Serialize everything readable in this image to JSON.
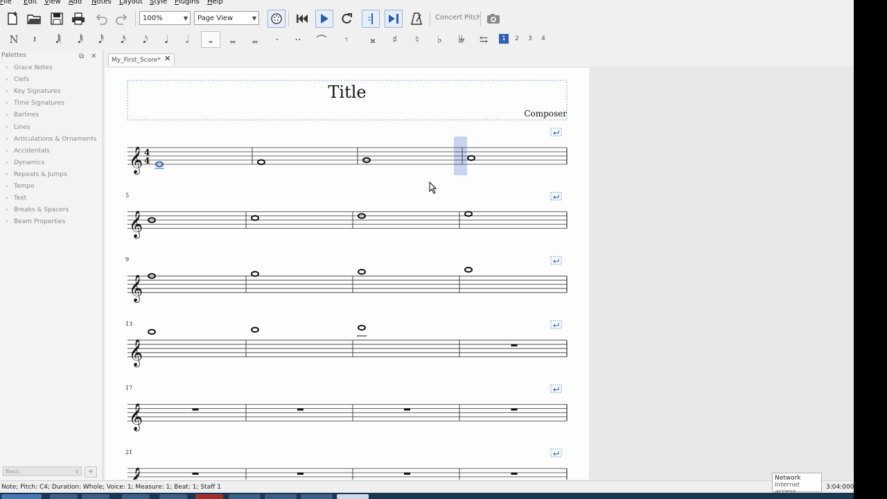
{
  "menu": [
    "File",
    "Edit",
    "View",
    "Add",
    "Notes",
    "Layout",
    "Style",
    "Plugins",
    "Help"
  ],
  "toolbar": {
    "zoom_value": "100%",
    "view_mode": "Page View",
    "concert_pitch": "Concert Pitch",
    "icons": [
      "new-score-icon",
      "open-icon",
      "save-icon",
      "print-icon",
      "undo-icon",
      "redo-icon",
      "midi-input-icon",
      "rewind-icon",
      "play-icon",
      "loop-icon",
      "loop-in-icon",
      "loop-out-icon",
      "metronome-icon",
      "image-capture-icon"
    ]
  },
  "note_input": {
    "buttons": [
      "N",
      "𝄽",
      "𝅘𝅥𝅲",
      "𝅘𝅥𝅱",
      "𝅘𝅥𝅰",
      "𝅘𝅥𝅯",
      "𝅘𝅥𝅮",
      "𝅘𝅥",
      "𝅗𝅥",
      "𝅝",
      "𝅜",
      "𝅜",
      "·",
      "··",
      "⌒",
      "𝄾",
      "𝄪",
      "♯",
      "♮",
      "♭",
      "𝄫",
      "⇆"
    ],
    "voices": [
      "1",
      "2",
      "3",
      "4"
    ],
    "active_voice": "1"
  },
  "palette": {
    "title": "Palettes",
    "items": [
      "Grace Notes",
      "Clefs",
      "Key Signatures",
      "Time Signatures",
      "Barlines",
      "Lines",
      "Articulations & Ornaments",
      "Accidentals",
      "Dynamics",
      "Repeats & Jumps",
      "Tempo",
      "Text",
      "Breaks & Spacers",
      "Beam Properties"
    ],
    "workspace": "Basic",
    "add_label": "+"
  },
  "tab": {
    "label": "My_First_Score*",
    "close": "✕"
  },
  "score": {
    "title": "Title",
    "composer": "Composer",
    "time_signature": [
      "4",
      "4"
    ],
    "measure_numbers": [
      "5",
      "9",
      "13",
      "17",
      "21"
    ],
    "systems": [
      [
        {
          "notes": [
            {
              "step": -2
            }
          ]
        },
        {
          "notes": [
            {
              "step": -1
            }
          ]
        },
        {
          "notes": [
            {
              "step": 0
            }
          ]
        },
        {
          "notes": [
            {
              "step": 1
            }
          ]
        }
      ],
      [
        {
          "notes": [
            {
              "step": 2
            }
          ]
        },
        {
          "notes": [
            {
              "step": 3
            }
          ]
        },
        {
          "notes": [
            {
              "step": 4
            }
          ]
        },
        {
          "notes": [
            {
              "step": 5
            }
          ]
        }
      ],
      [
        {
          "notes": [
            {
              "step": 6
            }
          ]
        },
        {
          "notes": [
            {
              "step": 7
            }
          ]
        },
        {
          "notes": [
            {
              "step": 8
            }
          ]
        },
        {
          "notes": [
            {
              "step": 9
            }
          ]
        }
      ],
      [
        {
          "notes": [
            {
              "step": 10
            }
          ]
        },
        {
          "notes": [
            {
              "step": 11
            }
          ]
        },
        {
          "notes": [
            {
              "step": 12
            }
          ]
        },
        {
          "rest": true
        }
      ],
      [
        {
          "rest": true
        },
        {
          "rest": true
        },
        {
          "rest": true
        },
        {
          "rest": true
        }
      ],
      [
        {
          "rest": true
        },
        {
          "rest": true
        },
        {
          "rest": true
        },
        {
          "rest": true
        }
      ]
    ]
  },
  "status": {
    "text": "Note; Pitch: C4; Duration: Whole; Voice: 1;  Measure: 1; Beat: 1; Staff 1",
    "clock": "3:04:000"
  },
  "network_popup": {
    "title": "Network",
    "subtitle": "Internet access"
  },
  "colors": {
    "selection": "#2f5fb3",
    "highlight": "#c6d4ef",
    "accent": "#3a6fd0"
  }
}
